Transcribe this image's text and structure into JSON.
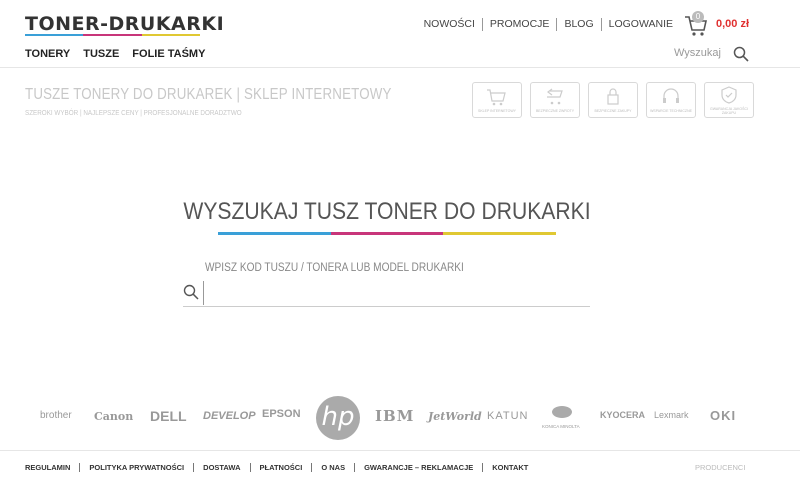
{
  "header": {
    "logo": "TONER-DRUKARKI",
    "logo_colors": [
      "#3aa0d8",
      "#c8357a",
      "#e0c832"
    ],
    "topnav": [
      "NOWOŚCI",
      "PROMOCJE",
      "BLOG",
      "LOGOWANIE"
    ],
    "cart_count": "0",
    "cart_total": "0,00 zł",
    "mainnav": [
      "TONERY",
      "TUSZE",
      "FOLIE TAŚMY"
    ],
    "search_label": "Wyszukaj"
  },
  "intro": {
    "title": "TUSZE TONERY DO DRUKAREK | SKLEP INTERNETOWY",
    "subtitle": "SZEROKI WYBÓR | NAJLEPSZE CENY | PROFESJONALNE DORADZTWO",
    "badges": [
      {
        "icon": "cart-icon",
        "label": "SKLEP INTERNETOWY"
      },
      {
        "icon": "return-icon",
        "label": "BEZPIECZNE ZWROTY"
      },
      {
        "icon": "lock-icon",
        "label": "BEZPIECZNE ZAKUPY"
      },
      {
        "icon": "headset-icon",
        "label": "WSPARCIE TECHNICZNE"
      },
      {
        "icon": "shield-icon",
        "label": "GWARANCJA JAKOŚCI ZAKUPU"
      }
    ]
  },
  "center": {
    "title": "WYSZUKAJ TUSZ TONER DO DRUKARKI",
    "hint": "WPISZ KOD TUSZU / TONERA LUB MODEL DRUKARKI",
    "input_value": ""
  },
  "brands": [
    "brother",
    "Canon",
    "DELL",
    "DEVELOP",
    "EPSON",
    "hp",
    "IBM",
    "JetWorld",
    "KATUN",
    "KONICA MINOLTA",
    "KYOCERA",
    "Lexmark",
    "OKI"
  ],
  "footer": {
    "links": [
      "REGULAMIN",
      "POLITYKA PRYWATNOŚCI",
      "DOSTAWA",
      "PŁATNOŚCI",
      "O NAS",
      "GWARANCJE – REKLAMACJE",
      "KONTAKT"
    ],
    "right": "PRODUCENCI"
  }
}
